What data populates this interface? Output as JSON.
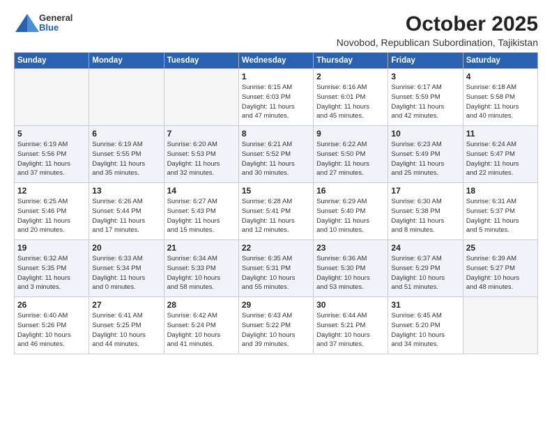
{
  "logo": {
    "general": "General",
    "blue": "Blue"
  },
  "title": "October 2025",
  "location": "Novobod, Republican Subordination, Tajikistan",
  "days_of_week": [
    "Sunday",
    "Monday",
    "Tuesday",
    "Wednesday",
    "Thursday",
    "Friday",
    "Saturday"
  ],
  "weeks": [
    [
      {
        "num": "",
        "info": ""
      },
      {
        "num": "",
        "info": ""
      },
      {
        "num": "",
        "info": ""
      },
      {
        "num": "1",
        "info": "Sunrise: 6:15 AM\nSunset: 6:03 PM\nDaylight: 11 hours\nand 47 minutes."
      },
      {
        "num": "2",
        "info": "Sunrise: 6:16 AM\nSunset: 6:01 PM\nDaylight: 11 hours\nand 45 minutes."
      },
      {
        "num": "3",
        "info": "Sunrise: 6:17 AM\nSunset: 5:59 PM\nDaylight: 11 hours\nand 42 minutes."
      },
      {
        "num": "4",
        "info": "Sunrise: 6:18 AM\nSunset: 5:58 PM\nDaylight: 11 hours\nand 40 minutes."
      }
    ],
    [
      {
        "num": "5",
        "info": "Sunrise: 6:19 AM\nSunset: 5:56 PM\nDaylight: 11 hours\nand 37 minutes."
      },
      {
        "num": "6",
        "info": "Sunrise: 6:19 AM\nSunset: 5:55 PM\nDaylight: 11 hours\nand 35 minutes."
      },
      {
        "num": "7",
        "info": "Sunrise: 6:20 AM\nSunset: 5:53 PM\nDaylight: 11 hours\nand 32 minutes."
      },
      {
        "num": "8",
        "info": "Sunrise: 6:21 AM\nSunset: 5:52 PM\nDaylight: 11 hours\nand 30 minutes."
      },
      {
        "num": "9",
        "info": "Sunrise: 6:22 AM\nSunset: 5:50 PM\nDaylight: 11 hours\nand 27 minutes."
      },
      {
        "num": "10",
        "info": "Sunrise: 6:23 AM\nSunset: 5:49 PM\nDaylight: 11 hours\nand 25 minutes."
      },
      {
        "num": "11",
        "info": "Sunrise: 6:24 AM\nSunset: 5:47 PM\nDaylight: 11 hours\nand 22 minutes."
      }
    ],
    [
      {
        "num": "12",
        "info": "Sunrise: 6:25 AM\nSunset: 5:46 PM\nDaylight: 11 hours\nand 20 minutes."
      },
      {
        "num": "13",
        "info": "Sunrise: 6:26 AM\nSunset: 5:44 PM\nDaylight: 11 hours\nand 17 minutes."
      },
      {
        "num": "14",
        "info": "Sunrise: 6:27 AM\nSunset: 5:43 PM\nDaylight: 11 hours\nand 15 minutes."
      },
      {
        "num": "15",
        "info": "Sunrise: 6:28 AM\nSunset: 5:41 PM\nDaylight: 11 hours\nand 12 minutes."
      },
      {
        "num": "16",
        "info": "Sunrise: 6:29 AM\nSunset: 5:40 PM\nDaylight: 11 hours\nand 10 minutes."
      },
      {
        "num": "17",
        "info": "Sunrise: 6:30 AM\nSunset: 5:38 PM\nDaylight: 11 hours\nand 8 minutes."
      },
      {
        "num": "18",
        "info": "Sunrise: 6:31 AM\nSunset: 5:37 PM\nDaylight: 11 hours\nand 5 minutes."
      }
    ],
    [
      {
        "num": "19",
        "info": "Sunrise: 6:32 AM\nSunset: 5:35 PM\nDaylight: 11 hours\nand 3 minutes."
      },
      {
        "num": "20",
        "info": "Sunrise: 6:33 AM\nSunset: 5:34 PM\nDaylight: 11 hours\nand 0 minutes."
      },
      {
        "num": "21",
        "info": "Sunrise: 6:34 AM\nSunset: 5:33 PM\nDaylight: 10 hours\nand 58 minutes."
      },
      {
        "num": "22",
        "info": "Sunrise: 6:35 AM\nSunset: 5:31 PM\nDaylight: 10 hours\nand 55 minutes."
      },
      {
        "num": "23",
        "info": "Sunrise: 6:36 AM\nSunset: 5:30 PM\nDaylight: 10 hours\nand 53 minutes."
      },
      {
        "num": "24",
        "info": "Sunrise: 6:37 AM\nSunset: 5:29 PM\nDaylight: 10 hours\nand 51 minutes."
      },
      {
        "num": "25",
        "info": "Sunrise: 6:39 AM\nSunset: 5:27 PM\nDaylight: 10 hours\nand 48 minutes."
      }
    ],
    [
      {
        "num": "26",
        "info": "Sunrise: 6:40 AM\nSunset: 5:26 PM\nDaylight: 10 hours\nand 46 minutes."
      },
      {
        "num": "27",
        "info": "Sunrise: 6:41 AM\nSunset: 5:25 PM\nDaylight: 10 hours\nand 44 minutes."
      },
      {
        "num": "28",
        "info": "Sunrise: 6:42 AM\nSunset: 5:24 PM\nDaylight: 10 hours\nand 41 minutes."
      },
      {
        "num": "29",
        "info": "Sunrise: 6:43 AM\nSunset: 5:22 PM\nDaylight: 10 hours\nand 39 minutes."
      },
      {
        "num": "30",
        "info": "Sunrise: 6:44 AM\nSunset: 5:21 PM\nDaylight: 10 hours\nand 37 minutes."
      },
      {
        "num": "31",
        "info": "Sunrise: 6:45 AM\nSunset: 5:20 PM\nDaylight: 10 hours\nand 34 minutes."
      },
      {
        "num": "",
        "info": ""
      }
    ]
  ]
}
